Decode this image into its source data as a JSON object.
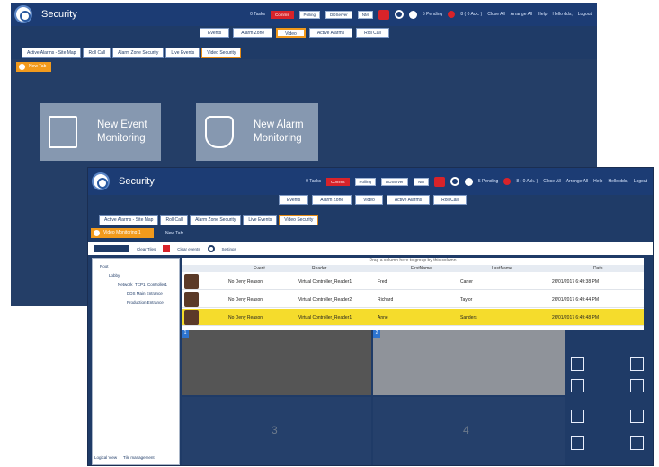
{
  "app": {
    "title": "Security"
  },
  "topbar": {
    "tasks": "0 Tasks",
    "comms": "Comms",
    "polling": "Polling",
    "ddserver": "DDServer",
    "nm": "NM",
    "pending": "5 Pending",
    "acked": "8 ( 0 Ack. )",
    "close_all": "Close All",
    "arrange_all": "Arrange All",
    "help": "Help",
    "hello": "Hello dds,",
    "logout": "Logout"
  },
  "quick_buttons": [
    "Events",
    "Alarm Zone",
    "Video",
    "Active Alarms",
    "Roll Call"
  ],
  "tabs": [
    "Active Alarms - Site Map",
    "Roll Call",
    "Alarm Zone Security",
    "Live Events",
    "Video Security"
  ],
  "back_window": {
    "new_tab": "New Tab",
    "tiles": [
      {
        "icon": "document-list-icon",
        "label_line1": "New Event",
        "label_line2": "Monitoring"
      },
      {
        "icon": "shield-alarm-icon",
        "label_line1": "New Alarm",
        "label_line2": "Monitoring"
      }
    ]
  },
  "front_window": {
    "subtab": "Video Monitoring 1",
    "new_tab": "New Tab",
    "toolbar": {
      "clear_tiles": "Clear Tiles",
      "clear_events": "Clear events",
      "settings": "Settings"
    },
    "tree": {
      "items": [
        "Root",
        "Lobby",
        "Network_TCP1_Controller1",
        "DDS Main Entrance",
        "Production Entrance"
      ],
      "bottom_tabs": [
        "Logical View",
        "Tile management"
      ]
    },
    "grid": {
      "group_hint": "Drag a column here to group by this column",
      "columns": [
        "Event",
        "Reader",
        "FirstName",
        "LastName",
        "Date"
      ],
      "rows": [
        {
          "event": "No Deny Reason",
          "reader": "Virtual Controller_Reader1",
          "first": "Fred",
          "last": "Carter",
          "date": "26/01/2017 6:49:38 PM",
          "selected": false
        },
        {
          "event": "No Deny Reason",
          "reader": "Virtual Controller_Reader2",
          "first": "Richard",
          "last": "Taylor",
          "date": "26/01/2017 6:49:44 PM",
          "selected": false
        },
        {
          "event": "No Deny Reason",
          "reader": "Virtual Controller_Reader1",
          "first": "Anne",
          "last": "Sanders",
          "date": "26/01/2017 6:49:48 PM",
          "selected": true
        }
      ]
    },
    "video_tiles": [
      "1",
      "2",
      "3",
      "4"
    ],
    "video_controls": [
      "rewind-icon",
      "pause-icon",
      "play-icon",
      "fast-forward-icon",
      "eye-icon",
      "camera-icon",
      "film-icon",
      "calendar-icon",
      "unlock-icon",
      "lock-icon",
      "shield-off-icon",
      "shield-icon"
    ]
  },
  "colors": {
    "window": "#1f3b67",
    "accent": "#f29a1c",
    "selected_row": "#f5dc2c",
    "alert": "#d8232a"
  }
}
